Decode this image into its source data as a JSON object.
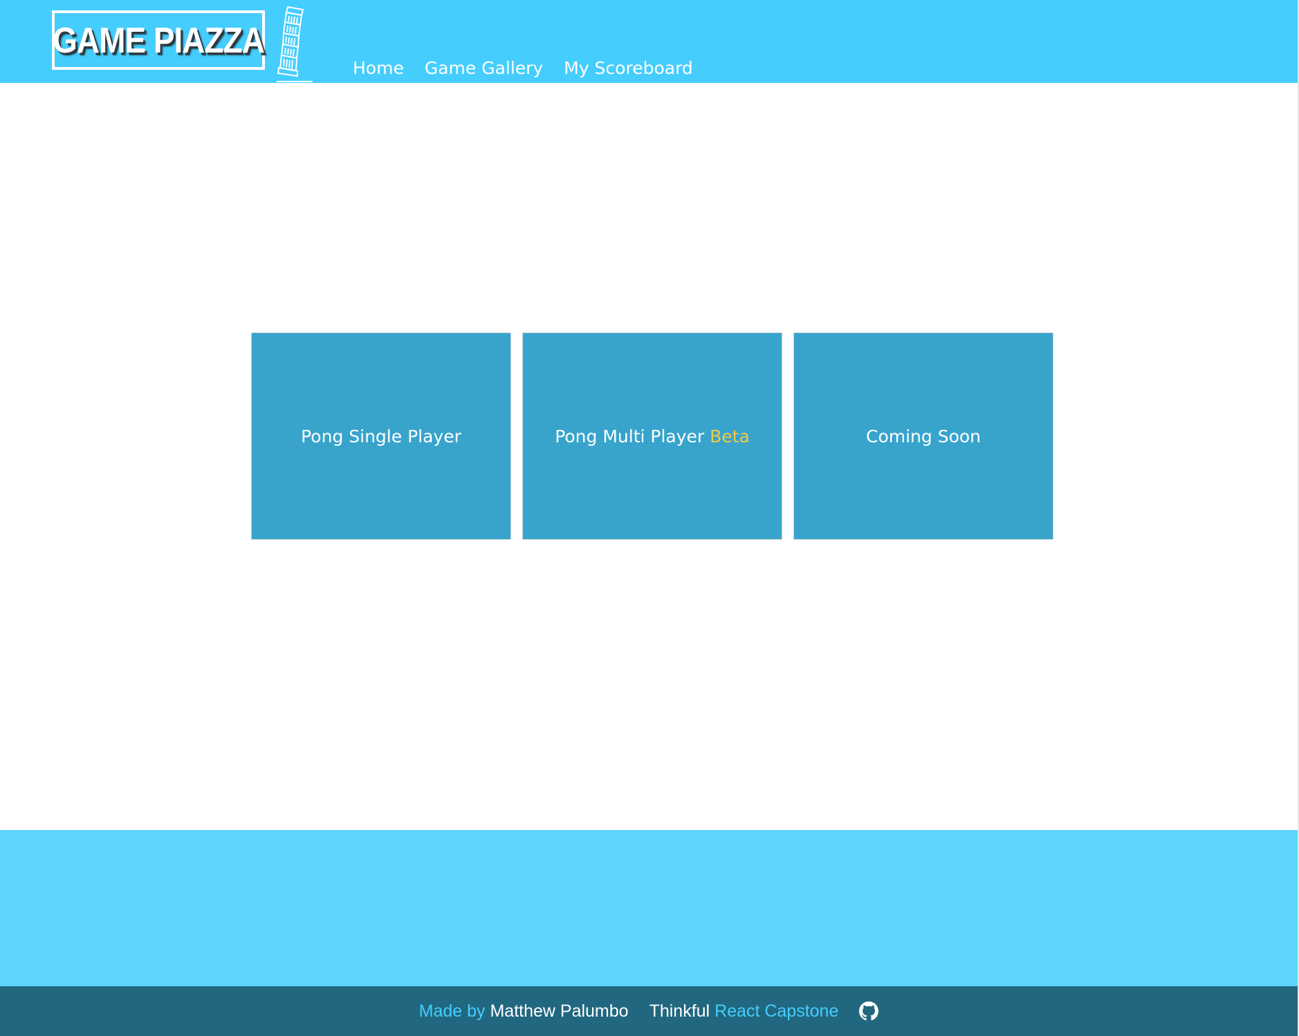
{
  "colors": {
    "header_bg": "#45cdfd",
    "card_bg": "#38a4cc",
    "beta_accent": "#f2c84b",
    "footer_top_bg": "#5dd3fe",
    "footer_bar_bg": "#21677f"
  },
  "header": {
    "logo_text": "GAME PIAZZA",
    "logo_icon": "leaning-tower-icon",
    "nav": {
      "home": "Home",
      "gallery": "Game Gallery",
      "scoreboard": "My Scoreboard"
    }
  },
  "games": {
    "pong_single": "Pong Single Player",
    "pong_multi": "Pong Multi Player",
    "pong_multi_badge": "Beta",
    "coming_soon": "Coming Soon"
  },
  "footer": {
    "made_by_label": "Made by",
    "author": "Matthew Palumbo",
    "school": "Thinkful",
    "project": "React Capstone",
    "repo_icon": "github-icon"
  }
}
